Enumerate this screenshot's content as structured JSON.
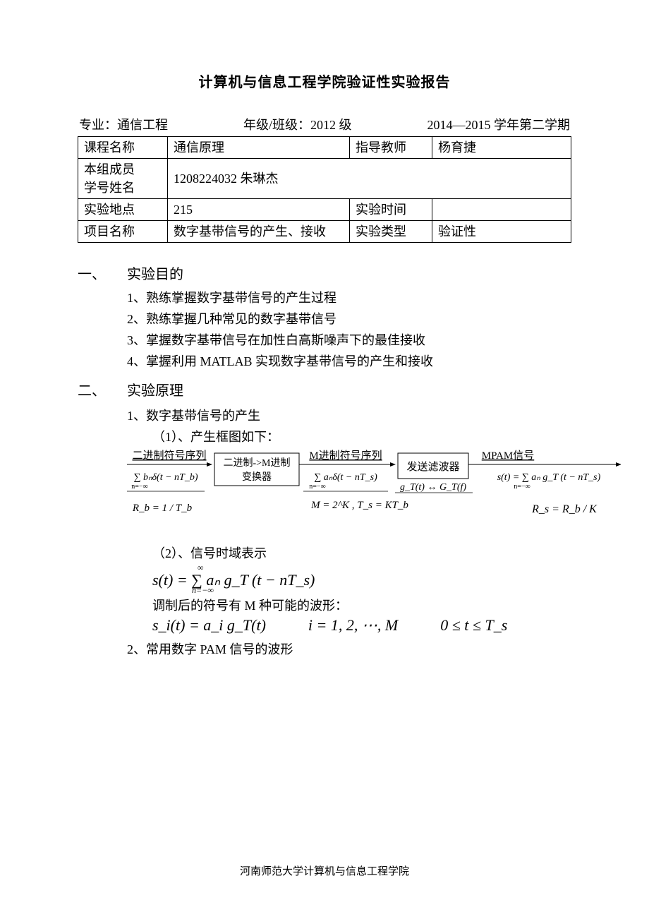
{
  "title": "计算机与信息工程学院验证性实验报告",
  "meta": {
    "major_label": "专业：",
    "major_value": "通信工程",
    "grade_label": "年级/班级：",
    "grade_value": "2012 级",
    "term": "2014—2015 学年第二学期"
  },
  "table": {
    "course_label": "课程名称",
    "course_value": "通信原理",
    "teacher_label": "指导教师",
    "teacher_value": "杨育捷",
    "members_label_line1": "本组成员",
    "members_label_line2": "学号姓名",
    "members_value": "1208224032  朱琳杰",
    "place_label": "实验地点",
    "place_value": "215",
    "time_label": "实验时间",
    "time_value": "",
    "project_label": "项目名称",
    "project_value": "数字基带信号的产生、接收",
    "type_label": "实验类型",
    "type_value": "验证性"
  },
  "sections": {
    "s1_num": "一、",
    "s1_title": "实验目的",
    "s1_items": {
      "i1": "1、熟练掌握数字基带信号的产生过程",
      "i2": "2、熟练掌握几种常见的数字基带信号",
      "i3": "3、掌握数字基带信号在加性白高斯噪声下的最佳接收",
      "i4": "4、掌握利用 MATLAB 实现数字基带信号的产生和接收"
    },
    "s2_num": "二、",
    "s2_title": "实验原理",
    "s2_1_head": "1、数字基带信号的产生",
    "s2_1_sub1": "（1）、产生框图如下：",
    "diagram": {
      "node1_top": "二进制符号序列",
      "node1_mid_a": "∑ bₙδ(t − nT_b)",
      "node1_mid_b": "n=−∞",
      "node1_bot": "R_b = 1 / T_b",
      "box1_line1": "二进制->M进制",
      "box1_line2": "变换器",
      "node2_top": "M进制符号序列",
      "node2_mid_a": "∑ aₙδ(t − nT_s)",
      "node2_mid_b": "n=−∞",
      "node2_bot": "M = 2^K , T_s = KT_b",
      "box2": "发送滤波器",
      "box2_under": "g_T(t) ↔ G_T(f)",
      "node3_top": "MPAM信号",
      "node3_mid_a": "s(t) = ∑ aₙ g_T (t − nT_s)",
      "node3_mid_b": "n=−∞",
      "node3_bot": "R_s = R_b / K"
    },
    "s2_1_sub2": "（2）、信号时域表示",
    "eq1_line1": "s(t) = ∑ aₙ g_T (t − nT_s)",
    "eq1_line2": "n=−∞",
    "eq1_line0": "∞",
    "s2_1_text2": "调制后的符号有 M 种可能的波形：",
    "eq2_a": "s_i(t) = a_i g_T(t)",
    "eq2_b": "i = 1, 2, ⋯, M",
    "eq2_c": "0 ≤ t ≤ T_s",
    "s2_2_head": "2、常用数字 PAM 信号的波形"
  },
  "footer": "河南师范大学计算机与信息工程学院"
}
